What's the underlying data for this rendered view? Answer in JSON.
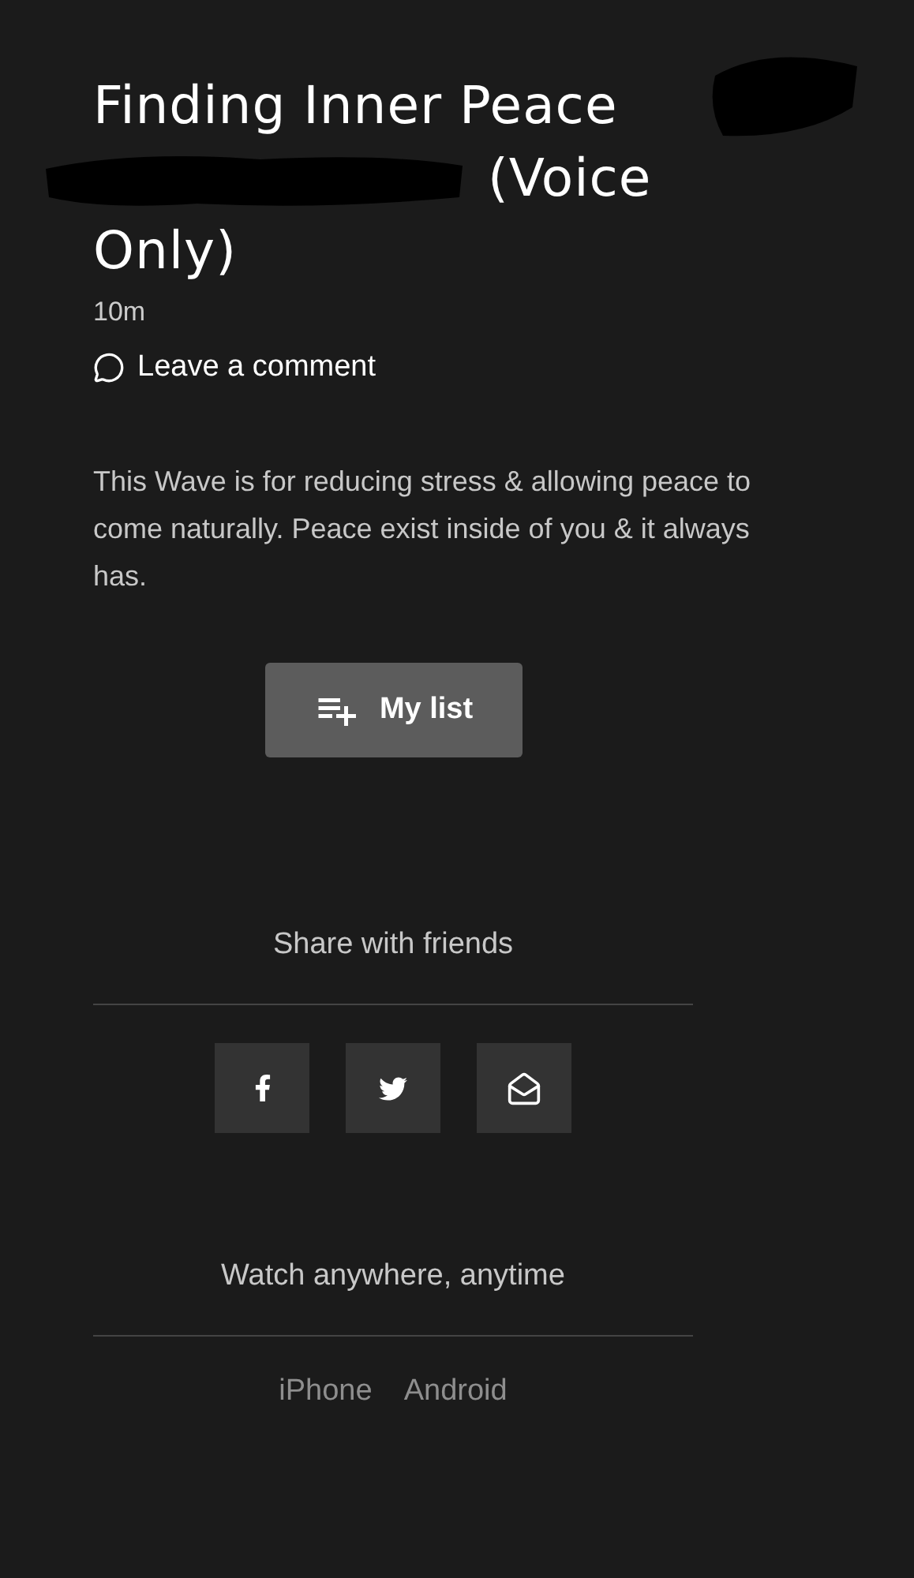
{
  "title_lines": [
    "Finding Inner Peace",
    "(Voice",
    "Only)"
  ],
  "duration": "10m",
  "comment_link": "Leave a comment",
  "description": "This Wave is for reducing stress & allowing peace to come naturally. Peace exist inside of you & it always has.",
  "my_list_button": "My list",
  "share": {
    "heading": "Share with friends",
    "buttons": [
      {
        "kind": "facebook"
      },
      {
        "kind": "twitter"
      },
      {
        "kind": "email"
      }
    ]
  },
  "apps": {
    "heading": "Watch anywhere, anytime",
    "links": [
      "iPhone",
      "Android"
    ]
  }
}
